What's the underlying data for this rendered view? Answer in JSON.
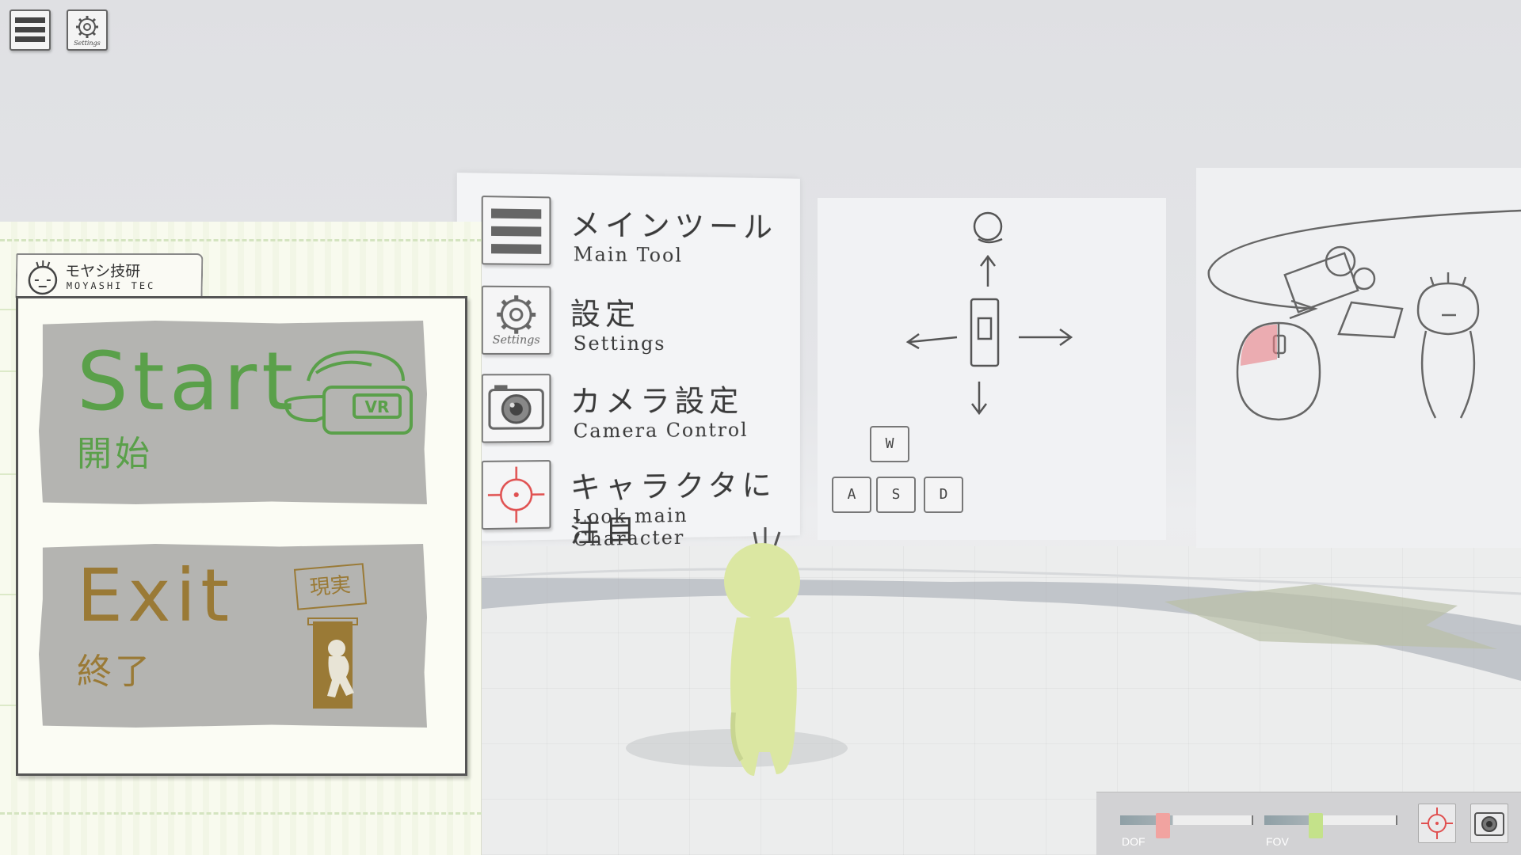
{
  "toolbar": {
    "menu_icon": "hamburger-menu-icon",
    "settings_icon": "gear-icon",
    "settings_caption": "Settings"
  },
  "brand": {
    "name_ja": "モヤシ技研",
    "name_en": "MOYASHI TEC"
  },
  "menu": {
    "start": {
      "label_en": "Start",
      "label_ja": "開始",
      "badge": "VR",
      "color": "#5aa04a"
    },
    "exit": {
      "label_en": "Exit",
      "label_ja": "終了",
      "sign": "現実",
      "color": "#9a7a36"
    }
  },
  "tutorial_board": {
    "items": [
      {
        "icon": "hamburger-menu-icon",
        "label_ja": "メインツール",
        "label_en": "Main Tool"
      },
      {
        "icon": "gear-icon",
        "icon_caption": "Settings",
        "label_ja": "設定",
        "label_en": "Settings"
      },
      {
        "icon": "camera-icon",
        "label_ja": "カメラ設定",
        "label_en": "Camera Control"
      },
      {
        "icon": "crosshair-icon",
        "label_ja": "キャラクタに注目",
        "label_en": "Look main Character"
      }
    ]
  },
  "controls_board": {
    "keys": [
      "W",
      "A",
      "S",
      "D"
    ]
  },
  "hud": {
    "dof_label": "DOF",
    "fov_label": "FOV",
    "dof_value": 0.3,
    "fov_value": 0.37,
    "target_icon": "crosshair-icon",
    "camera_icon": "camera-icon",
    "dof_color": "#f1a3a0",
    "fov_color": "#c4e28a"
  }
}
